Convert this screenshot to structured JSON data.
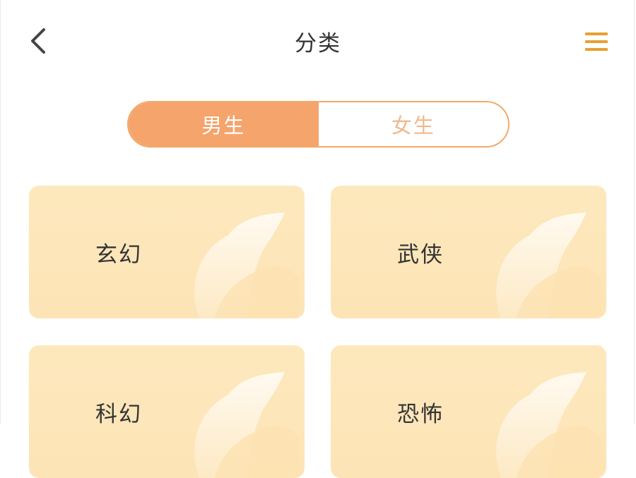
{
  "header": {
    "title": "分类",
    "back_icon": "chevron-left-icon",
    "menu_icon": "menu-icon"
  },
  "tabs": [
    {
      "label": "男生",
      "active": true
    },
    {
      "label": "女生",
      "active": false
    }
  ],
  "categories": [
    {
      "label": "玄幻"
    },
    {
      "label": "武侠"
    },
    {
      "label": "科幻"
    },
    {
      "label": "恐怖"
    }
  ],
  "colors": {
    "accent": "#f5a46b",
    "menu_icon": "#e8a030",
    "card_bg": "#fde6b9",
    "text": "#333333"
  }
}
